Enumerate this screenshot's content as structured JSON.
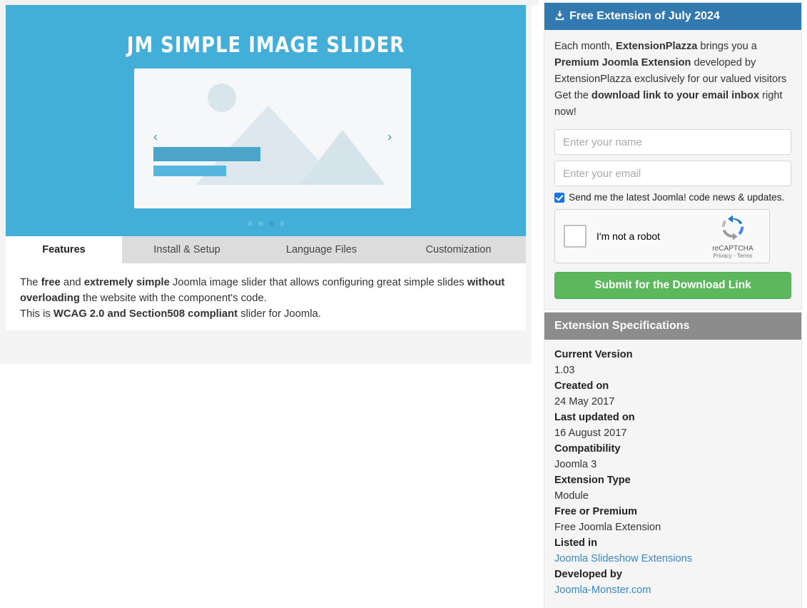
{
  "banner": {
    "title": "JM SIMPLE IMAGE SLIDER",
    "prev_arrow": "‹",
    "next_arrow": "›",
    "dots_count": 4,
    "active_dot_index": 2,
    "background_color": "#43afd8"
  },
  "tabs": [
    {
      "label": "Features",
      "active": true
    },
    {
      "label": "Install & Setup",
      "active": false
    },
    {
      "label": "Language Files",
      "active": false
    },
    {
      "label": "Customization",
      "active": false
    }
  ],
  "features": {
    "line1_a": "The ",
    "line1_b": "free",
    "line1_c": " and ",
    "line1_d": "extremely simple",
    "line1_e": " Joomla image slider that allows configuring great simple slides ",
    "line2_a": "without overloading",
    "line2_b": " the website with the component's code.",
    "line3_a": "This is ",
    "line3_b": "WCAG 2.0 and Section508 compliant",
    "line3_c": " slider for Joomla."
  },
  "free_extension": {
    "header_title": "Free Extension of July 2024",
    "header_icon": "download-icon",
    "header_color": "#3279b0",
    "intro_a": "Each month, ",
    "intro_b": "ExtensionPlazza",
    "intro_c": " brings you a ",
    "intro_d": "Premium Joomla Extension",
    "intro_e": " developed by ExtensionPlazza exclusively for our valued visitors",
    "intro_f": "Get the ",
    "intro_g": "download link to your email inbox",
    "intro_h": " right now!",
    "name_value": "",
    "name_placeholder": "Enter your name",
    "email_value": "",
    "email_placeholder": "Enter your email",
    "newsletter_label": "Send me the latest Joomla! code news & updates.",
    "newsletter_checked": true,
    "recaptcha_label": "I'm not a robot",
    "recaptcha_brand": "reCAPTCHA",
    "recaptcha_legal": "Privacy - Terms",
    "submit_label": "Submit for the Download Link",
    "submit_color": "#5cb85c"
  },
  "specifications": {
    "header_title": "Extension Specifications",
    "header_color": "#8c8c8c",
    "rows": [
      {
        "label": "Current Version",
        "value": "1.03",
        "link": false
      },
      {
        "label": "Created on",
        "value": "24 May 2017",
        "link": false
      },
      {
        "label": "Last updated on",
        "value": "16 August 2017",
        "link": false
      },
      {
        "label": "Compatibility",
        "value": "Joomla 3",
        "link": false
      },
      {
        "label": "Extension Type",
        "value": "Module",
        "link": false
      },
      {
        "label": "Free or Premium",
        "value": "Free Joomla Extension",
        "link": false
      },
      {
        "label": "Listed in",
        "value": "Joomla Slideshow Extensions",
        "link": true
      },
      {
        "label": "Developed by",
        "value": "Joomla-Monster.com",
        "link": true
      }
    ]
  }
}
